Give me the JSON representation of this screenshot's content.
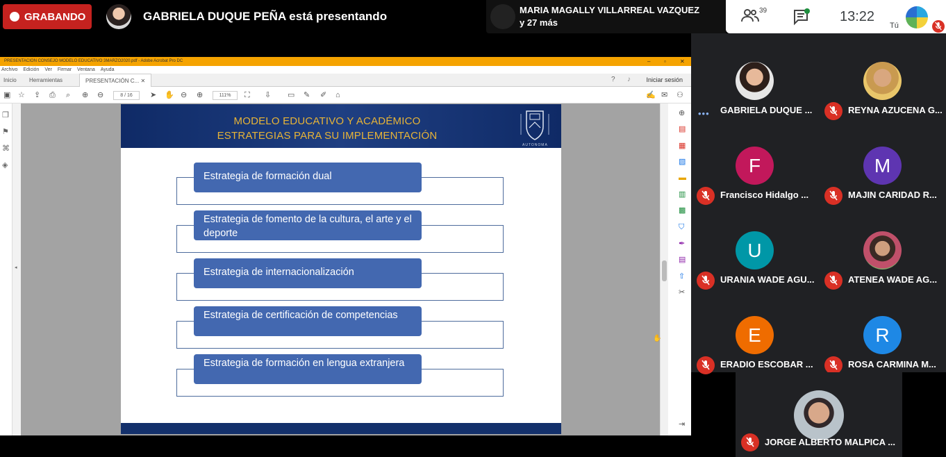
{
  "meet": {
    "recording_label": "GRABANDO",
    "presenter_text": "GABRIELA DUQUE PEÑA está presentando",
    "others_line1": "MARIA MAGALLY VILLARREAL VAZQUEZ",
    "others_line2": "y 27 más",
    "participants_count": "39",
    "time": "13:22",
    "self_label": "Tú"
  },
  "acrobat": {
    "title": "PRESENTACION CONSEJO MODELO EDUCATIVO 3MARZO2020.pdf - Adobe Acrobat Pro DC",
    "menu": [
      "Archivo",
      "Edición",
      "Ver",
      "Firmar",
      "Ventana",
      "Ayuda"
    ],
    "tabs": [
      "Inicio",
      "Herramientas",
      "PRESENTACIÓN C..."
    ],
    "signin": "Iniciar sesión",
    "page_indicator": "8 / 16",
    "zoom": "111%"
  },
  "slide": {
    "title_line1": "MODELO EDUCATIVO Y ACADÉMICO",
    "title_line2": "ESTRATEGIAS PARA SU IMPLEMENTACIÓN",
    "logo_word": "AUTONOMA",
    "strategies": [
      "Estrategia de formación dual",
      "Estrategia de fomento de la cultura, el arte y el deporte",
      "Estrategia de internacionalización",
      "Estrategia de certificación de competencias",
      "Estrategia de formación en lengua extranjera"
    ]
  },
  "participants": [
    {
      "name": "GABRIELA DUQUE ...",
      "initial": "",
      "color": "#7a5a4a",
      "muted": false
    },
    {
      "name": "REYNA AZUCENA G...",
      "initial": "",
      "color": "#e6c15a",
      "muted": true
    },
    {
      "name": "Francisco Hidalgo ...",
      "initial": "F",
      "color": "#c2185b",
      "muted": true
    },
    {
      "name": "MAJIN CARIDAD R...",
      "initial": "M",
      "color": "#5e35b1",
      "muted": true
    },
    {
      "name": "URANIA WADE AGU...",
      "initial": "U",
      "color": "#0097a7",
      "muted": true
    },
    {
      "name": "ATENEA WADE AG...",
      "initial": "",
      "color": "#b48a6a",
      "muted": true
    },
    {
      "name": "ERADIO ESCOBAR ...",
      "initial": "E",
      "color": "#ef6c00",
      "muted": true
    },
    {
      "name": "ROSA CARMINA M...",
      "initial": "R",
      "color": "#1e88e5",
      "muted": true
    }
  ],
  "last_participant": {
    "name": "JORGE ALBERTO MALPICA ..."
  }
}
